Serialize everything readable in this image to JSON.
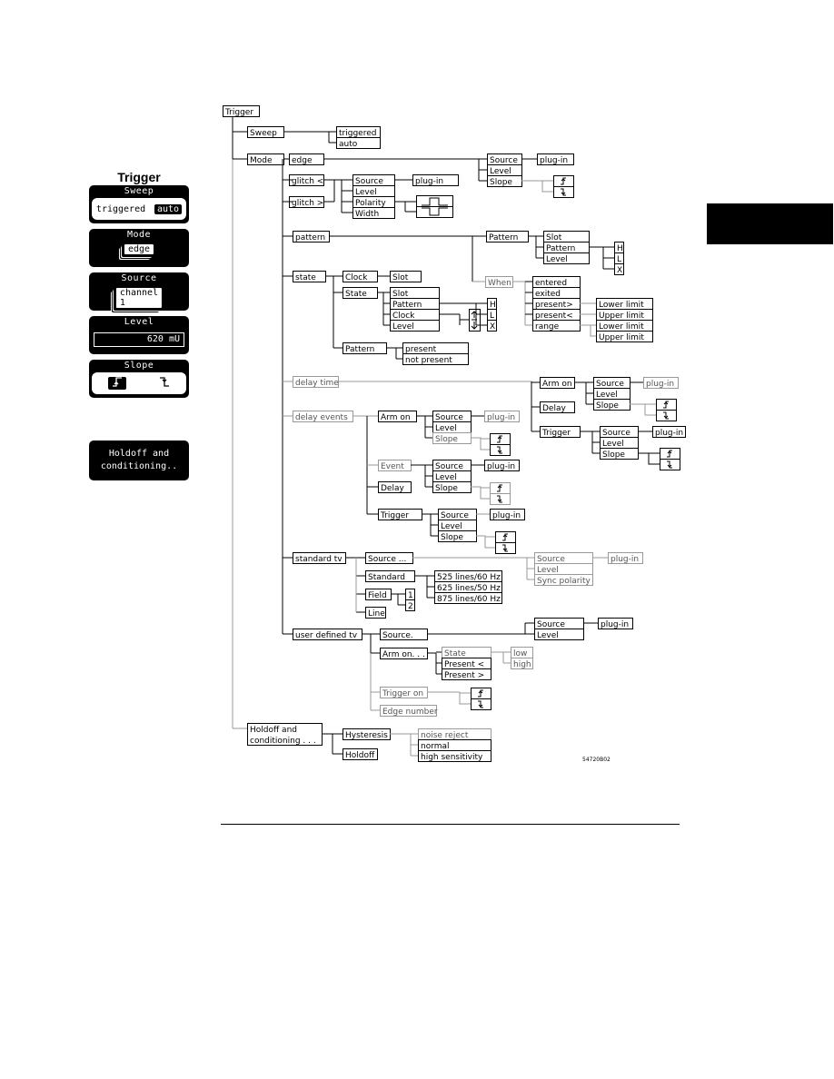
{
  "left_panel": {
    "title": "Trigger",
    "softkeys": {
      "sweep": {
        "label": "Sweep",
        "options": [
          "triggered",
          "auto"
        ],
        "selected": "auto"
      },
      "mode": {
        "label": "Mode",
        "value": "edge"
      },
      "source": {
        "label": "Source",
        "value": "channel 1"
      },
      "level": {
        "label": "Level",
        "value": "620 mU"
      },
      "slope": {
        "label": "Slope",
        "options": [
          "rising-edge",
          "falling-edge"
        ],
        "selected": "rising-edge",
        "rising_glyph": "↗",
        "falling_glyph": "↘"
      },
      "holdoff": {
        "line1": "Holdoff and",
        "line2": "conditioning.."
      }
    }
  },
  "diagram": {
    "figure_id": "54720B02",
    "nodes": [
      {
        "id": "trigger",
        "label": "Trigger"
      },
      {
        "id": "sweep",
        "label": "Sweep"
      },
      {
        "id": "sweep-triggered",
        "label": "triggered"
      },
      {
        "id": "sweep-auto",
        "label": "auto"
      },
      {
        "id": "mode",
        "label": "Mode"
      },
      {
        "id": "edge",
        "label": "edge"
      },
      {
        "id": "edge-source",
        "label": "Source"
      },
      {
        "id": "edge-source-plugin",
        "label": "plug-in"
      },
      {
        "id": "edge-level",
        "label": "Level"
      },
      {
        "id": "edge-slope",
        "label": "Slope"
      },
      {
        "id": "glitch-lt",
        "label": "glitch <"
      },
      {
        "id": "glitch-gt",
        "label": "glitch >"
      },
      {
        "id": "glitch-source",
        "label": "Source"
      },
      {
        "id": "glitch-source-plugin",
        "label": "plug-in"
      },
      {
        "id": "glitch-level",
        "label": "Level"
      },
      {
        "id": "glitch-polarity",
        "label": "Polarity"
      },
      {
        "id": "glitch-width",
        "label": "Width"
      },
      {
        "id": "pattern",
        "label": "pattern"
      },
      {
        "id": "pattern-pattern",
        "label": "Pattern"
      },
      {
        "id": "pattern-slot",
        "label": "Slot"
      },
      {
        "id": "pattern-pattern2",
        "label": "Pattern"
      },
      {
        "id": "pattern-level",
        "label": "Level"
      },
      {
        "id": "pattern-h",
        "label": "H"
      },
      {
        "id": "pattern-l",
        "label": "L"
      },
      {
        "id": "pattern-x",
        "label": "X"
      },
      {
        "id": "pattern-when",
        "label": "When"
      },
      {
        "id": "when-entered",
        "label": "entered"
      },
      {
        "id": "when-exited",
        "label": "exited"
      },
      {
        "id": "when-present-gt",
        "label": "present>"
      },
      {
        "id": "when-present-lt",
        "label": "present<"
      },
      {
        "id": "when-range",
        "label": "range"
      },
      {
        "id": "lower-limit-1",
        "label": "Lower limit"
      },
      {
        "id": "upper-limit-1",
        "label": "Upper limit"
      },
      {
        "id": "lower-limit-2",
        "label": "Lower limit"
      },
      {
        "id": "upper-limit-2",
        "label": "Upper limit"
      },
      {
        "id": "state",
        "label": "state"
      },
      {
        "id": "state-clock",
        "label": "Clock"
      },
      {
        "id": "state-clock-slot",
        "label": "Slot"
      },
      {
        "id": "state-state",
        "label": "State"
      },
      {
        "id": "state-slot",
        "label": "Slot"
      },
      {
        "id": "state-pattern",
        "label": "Pattern"
      },
      {
        "id": "state-clock2",
        "label": "Clock"
      },
      {
        "id": "state-level",
        "label": "Level"
      },
      {
        "id": "state-h",
        "label": "H"
      },
      {
        "id": "state-l",
        "label": "L"
      },
      {
        "id": "state-x",
        "label": "X"
      },
      {
        "id": "state-patternq",
        "label": "Pattern"
      },
      {
        "id": "state-present",
        "label": "present"
      },
      {
        "id": "state-not-present",
        "label": "not present"
      },
      {
        "id": "delay-time",
        "label": "delay time"
      },
      {
        "id": "dt-arm-on",
        "label": "Arm on"
      },
      {
        "id": "dt-arm-source",
        "label": "Source"
      },
      {
        "id": "dt-arm-plugin",
        "label": "plug-in"
      },
      {
        "id": "dt-arm-level",
        "label": "Level"
      },
      {
        "id": "dt-arm-slope",
        "label": "Slope"
      },
      {
        "id": "dt-delay",
        "label": "Delay"
      },
      {
        "id": "dt-trigger",
        "label": "Trigger"
      },
      {
        "id": "dt-trig-source",
        "label": "Source"
      },
      {
        "id": "dt-trig-plugin",
        "label": "plug-in"
      },
      {
        "id": "dt-trig-level",
        "label": "Level"
      },
      {
        "id": "dt-trig-slope",
        "label": "Slope"
      },
      {
        "id": "delay-events",
        "label": "delay events"
      },
      {
        "id": "de-arm-on",
        "label": "Arm on"
      },
      {
        "id": "de-arm-source",
        "label": "Source"
      },
      {
        "id": "de-arm-plugin",
        "label": "plug-in"
      },
      {
        "id": "de-arm-level",
        "label": "Level"
      },
      {
        "id": "de-arm-slope",
        "label": "Slope"
      },
      {
        "id": "de-event",
        "label": "Event"
      },
      {
        "id": "de-ev-source",
        "label": "Source"
      },
      {
        "id": "de-ev-plugin",
        "label": "plug-in"
      },
      {
        "id": "de-ev-level",
        "label": "Level"
      },
      {
        "id": "de-ev-slope",
        "label": "Slope"
      },
      {
        "id": "de-delay",
        "label": "Delay"
      },
      {
        "id": "de-trigger",
        "label": "Trigger"
      },
      {
        "id": "de-trig-source",
        "label": "Source"
      },
      {
        "id": "de-trig-plugin",
        "label": "plug-in"
      },
      {
        "id": "de-trig-level",
        "label": "Level"
      },
      {
        "id": "de-trig-slope",
        "label": "Slope"
      },
      {
        "id": "standard-tv",
        "label": "standard tv"
      },
      {
        "id": "stv-source",
        "label": "Source ..."
      },
      {
        "id": "stv-src-source",
        "label": "Source"
      },
      {
        "id": "stv-src-plugin",
        "label": "plug-in"
      },
      {
        "id": "stv-src-level",
        "label": "Level"
      },
      {
        "id": "stv-src-sync",
        "label": "Sync polarity"
      },
      {
        "id": "stv-standard",
        "label": "Standard"
      },
      {
        "id": "stv-525",
        "label": "525 lines/60 Hz"
      },
      {
        "id": "stv-625",
        "label": "625 lines/50 Hz"
      },
      {
        "id": "stv-875",
        "label": "875 lines/60 Hz"
      },
      {
        "id": "stv-field",
        "label": "Field"
      },
      {
        "id": "stv-field-1",
        "label": "1"
      },
      {
        "id": "stv-field-2",
        "label": "2"
      },
      {
        "id": "stv-line",
        "label": "Line"
      },
      {
        "id": "user-tv",
        "label": "user defined tv"
      },
      {
        "id": "utv-source",
        "label": "Source."
      },
      {
        "id": "utv-src-source",
        "label": "Source"
      },
      {
        "id": "utv-src-plugin",
        "label": "plug-in"
      },
      {
        "id": "utv-src-level",
        "label": "Level"
      },
      {
        "id": "utv-arm-on",
        "label": "Arm on. . ."
      },
      {
        "id": "utv-state",
        "label": "State"
      },
      {
        "id": "utv-present-lt",
        "label": "Present <"
      },
      {
        "id": "utv-present-gt",
        "label": "Present >"
      },
      {
        "id": "utv-low",
        "label": "low"
      },
      {
        "id": "utv-high",
        "label": "high"
      },
      {
        "id": "utv-trigger-on",
        "label": "Trigger on"
      },
      {
        "id": "utv-edge-number",
        "label": "Edge number"
      },
      {
        "id": "holdoff",
        "label": "Holdoff and|conditioning . . ."
      },
      {
        "id": "hysteresis",
        "label": "Hysteresis"
      },
      {
        "id": "hyst-noise",
        "label": "noise reject"
      },
      {
        "id": "hyst-normal",
        "label": "normal"
      },
      {
        "id": "hyst-high",
        "label": "high sensitivity"
      },
      {
        "id": "holdoff-holdoff",
        "label": "Holdoff"
      }
    ]
  }
}
